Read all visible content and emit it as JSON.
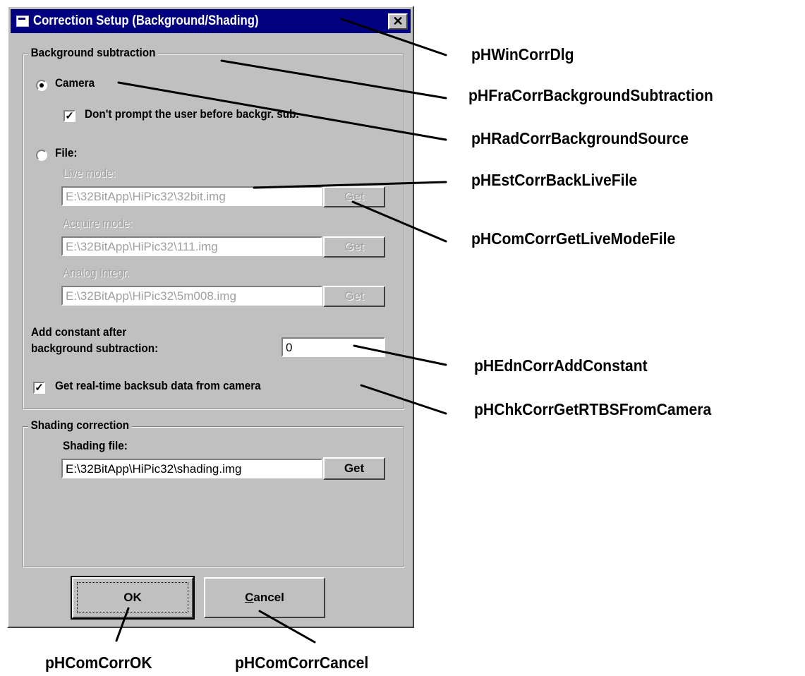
{
  "dialog": {
    "title": "Correction Setup (Background/Shading)",
    "close_symbol": "✕",
    "background_group": {
      "legend": "Background subtraction",
      "camera_radio_label": "Camera",
      "camera_selected": true,
      "dont_prompt_label": "Don't prompt the user before backgr. sub.",
      "dont_prompt_checked": true,
      "file_radio_label": "File:",
      "file_selected": false,
      "live_mode_label": "Live mode:",
      "live_mode_value": "E:\\32BitApp\\HiPic32\\32bit.img",
      "acquire_mode_label": "Acquire mode:",
      "acquire_mode_value": "E:\\32BitApp\\HiPic32\\111.img",
      "analog_integr_label": "Analog Integr.",
      "analog_integr_value": "E:\\32BitApp\\HiPic32\\5m008.img",
      "get_label": "Get",
      "add_constant_label_line1": "Add constant after",
      "add_constant_label_line2": "background subtraction:",
      "add_constant_value": "0",
      "rtbs_label": "Get real-time backsub data from camera",
      "rtbs_checked": true
    },
    "shading_group": {
      "legend": "Shading correction",
      "file_label": "Shading file:",
      "file_value": "E:\\32BitApp\\HiPic32\\shading.img",
      "get_label": "Get"
    },
    "ok_label": "OK",
    "cancel_label_first": "C",
    "cancel_label_rest": "ancel"
  },
  "annotations": {
    "win": "pHWinCorrDlg",
    "frame": "pHFraCorrBackgroundSubtraction",
    "radio": "pHRadCorrBackgroundSource",
    "live_file": "pHEstCorrBackLiveFile",
    "get_live": "pHComCorrGetLiveModeFile",
    "add_constant": "pHEdnCorrAddConstant",
    "rtbs": "pHChkCorrGetRTBSFromCamera",
    "ok": "pHComCorrOK",
    "cancel": "pHComCorrCancel"
  },
  "colors": {
    "titlebar": "#000080",
    "face": "#c0c0c0",
    "disabled_text": "#a0a0a0"
  }
}
